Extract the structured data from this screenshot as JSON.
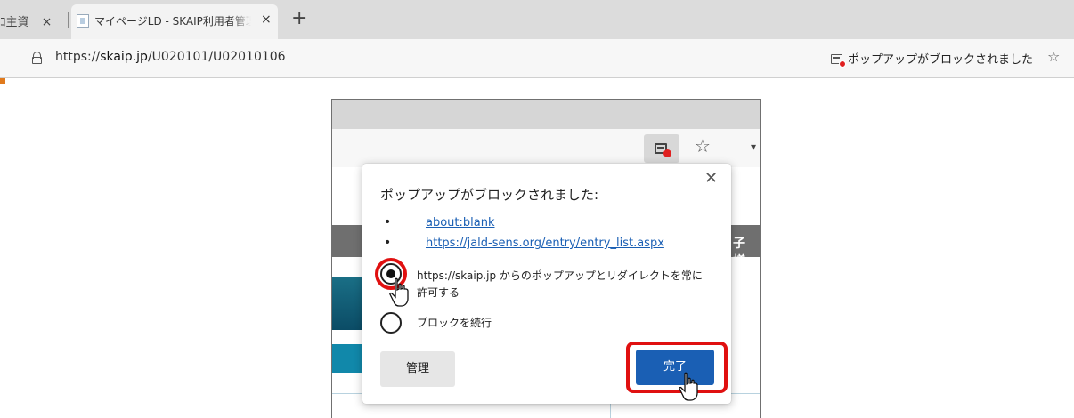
{
  "browser": {
    "prev_tab": {
      "label": "ｺ主資",
      "close": "×"
    },
    "active_tab": {
      "title": "マイページLD - SKAIP利用者管理シ",
      "close": "×"
    },
    "new_tab": "+",
    "address": {
      "scheme": "https://",
      "host": "skaip.jp",
      "path": "/U020101/U02010106"
    },
    "popup_blocked_indicator": "ポップアップがブロックされました",
    "favorite_icon": "☆"
  },
  "zoom_view": {
    "star_icon": "☆",
    "caret": "▾",
    "band_label": "子 様"
  },
  "dialog": {
    "title": "ポップアップがブロックされました:",
    "close": "✕",
    "bullets": [
      "•",
      "•"
    ],
    "links": [
      "about:blank",
      "https://jald-sens.org/entry/entry_list.aspx"
    ],
    "options": [
      {
        "line1": "https://skaip.jp からのポップアップとリダイレクトを常に",
        "line2": "許可する",
        "selected": true
      },
      {
        "line1": "ブロックを続行",
        "selected": false
      }
    ],
    "manage_button": "管理",
    "done_button": "完了"
  },
  "colors": {
    "accent_blue": "#1a5fb4",
    "highlight_red": "#e01010",
    "blocked_badge": "#e02020"
  },
  "icons": [
    "lock-icon",
    "popup-blocked-icon",
    "star-icon",
    "close-icon",
    "cursor-icon"
  ]
}
